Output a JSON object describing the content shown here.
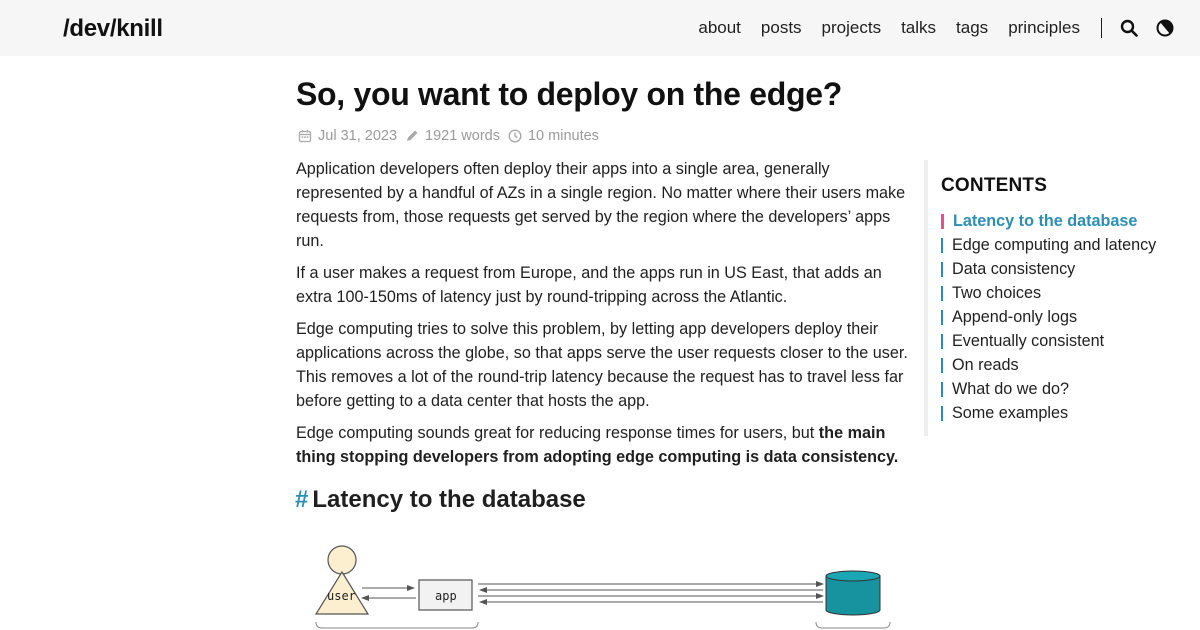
{
  "site": {
    "logo": "/dev/knill",
    "nav": [
      "about",
      "posts",
      "projects",
      "talks",
      "tags",
      "principles"
    ],
    "icons": [
      "search-icon",
      "theme-toggle-icon"
    ]
  },
  "post": {
    "title": "So, you want to deploy on the edge?",
    "date": "Jul 31, 2023",
    "words": "1921 words",
    "reading_time": "10 minutes",
    "paragraphs": [
      "Application developers often deploy their apps into a single area, generally represented by a handful of AZs in a single region. No matter where their users make requests from, those requests get served by the region where the developers’ apps run.",
      "If a user makes a request from Europe, and the apps run in US East, that adds an extra 100-150ms of latency just by round-tripping across the Atlantic.",
      "Edge computing tries to solve this problem, by letting app developers deploy their applications across the globe, so that apps serve the user requests closer to the user. This removes a lot of the round-trip latency because the request has to travel less far before getting to a data center that hosts the app."
    ],
    "p4_plain": "Edge computing sounds great for reducing response times for users, but ",
    "p4_bold": "the main thing stopping developers from adopting edge computing is data consistency.",
    "section_hash": "#",
    "section_heading": "Latency to the database",
    "diagram": {
      "user_label": "user",
      "app_label": "app",
      "colors": {
        "user": "#fbefcf",
        "db": "#16939e",
        "accent": "#2b8fb5",
        "active_marker": "#e6508f"
      }
    }
  },
  "toc": {
    "title": "CONTENTS",
    "items": [
      "Latency to the database",
      "Edge computing and latency",
      "Data consistency",
      "Two choices",
      "Append-only logs",
      "Eventually consistent",
      "On reads",
      "What do we do?",
      "Some examples"
    ],
    "active_index": 0
  }
}
